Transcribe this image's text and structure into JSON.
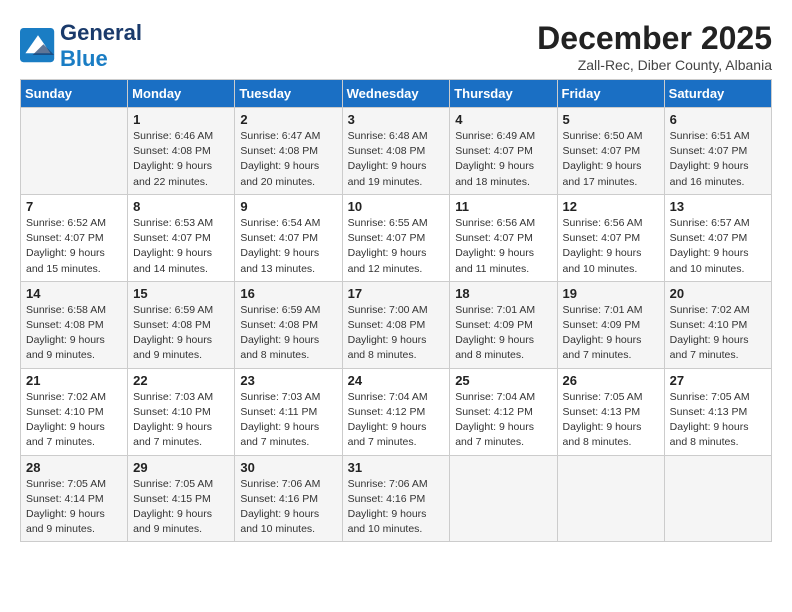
{
  "logo": {
    "general": "General",
    "blue": "Blue"
  },
  "title": "December 2025",
  "location": "Zall-Rec, Diber County, Albania",
  "days_of_week": [
    "Sunday",
    "Monday",
    "Tuesday",
    "Wednesday",
    "Thursday",
    "Friday",
    "Saturday"
  ],
  "weeks": [
    [
      {
        "day": "",
        "info": ""
      },
      {
        "day": "1",
        "info": "Sunrise: 6:46 AM\nSunset: 4:08 PM\nDaylight: 9 hours\nand 22 minutes."
      },
      {
        "day": "2",
        "info": "Sunrise: 6:47 AM\nSunset: 4:08 PM\nDaylight: 9 hours\nand 20 minutes."
      },
      {
        "day": "3",
        "info": "Sunrise: 6:48 AM\nSunset: 4:08 PM\nDaylight: 9 hours\nand 19 minutes."
      },
      {
        "day": "4",
        "info": "Sunrise: 6:49 AM\nSunset: 4:07 PM\nDaylight: 9 hours\nand 18 minutes."
      },
      {
        "day": "5",
        "info": "Sunrise: 6:50 AM\nSunset: 4:07 PM\nDaylight: 9 hours\nand 17 minutes."
      },
      {
        "day": "6",
        "info": "Sunrise: 6:51 AM\nSunset: 4:07 PM\nDaylight: 9 hours\nand 16 minutes."
      }
    ],
    [
      {
        "day": "7",
        "info": "Sunrise: 6:52 AM\nSunset: 4:07 PM\nDaylight: 9 hours\nand 15 minutes."
      },
      {
        "day": "8",
        "info": "Sunrise: 6:53 AM\nSunset: 4:07 PM\nDaylight: 9 hours\nand 14 minutes."
      },
      {
        "day": "9",
        "info": "Sunrise: 6:54 AM\nSunset: 4:07 PM\nDaylight: 9 hours\nand 13 minutes."
      },
      {
        "day": "10",
        "info": "Sunrise: 6:55 AM\nSunset: 4:07 PM\nDaylight: 9 hours\nand 12 minutes."
      },
      {
        "day": "11",
        "info": "Sunrise: 6:56 AM\nSunset: 4:07 PM\nDaylight: 9 hours\nand 11 minutes."
      },
      {
        "day": "12",
        "info": "Sunrise: 6:56 AM\nSunset: 4:07 PM\nDaylight: 9 hours\nand 10 minutes."
      },
      {
        "day": "13",
        "info": "Sunrise: 6:57 AM\nSunset: 4:07 PM\nDaylight: 9 hours\nand 10 minutes."
      }
    ],
    [
      {
        "day": "14",
        "info": "Sunrise: 6:58 AM\nSunset: 4:08 PM\nDaylight: 9 hours\nand 9 minutes."
      },
      {
        "day": "15",
        "info": "Sunrise: 6:59 AM\nSunset: 4:08 PM\nDaylight: 9 hours\nand 9 minutes."
      },
      {
        "day": "16",
        "info": "Sunrise: 6:59 AM\nSunset: 4:08 PM\nDaylight: 9 hours\nand 8 minutes."
      },
      {
        "day": "17",
        "info": "Sunrise: 7:00 AM\nSunset: 4:08 PM\nDaylight: 9 hours\nand 8 minutes."
      },
      {
        "day": "18",
        "info": "Sunrise: 7:01 AM\nSunset: 4:09 PM\nDaylight: 9 hours\nand 8 minutes."
      },
      {
        "day": "19",
        "info": "Sunrise: 7:01 AM\nSunset: 4:09 PM\nDaylight: 9 hours\nand 7 minutes."
      },
      {
        "day": "20",
        "info": "Sunrise: 7:02 AM\nSunset: 4:10 PM\nDaylight: 9 hours\nand 7 minutes."
      }
    ],
    [
      {
        "day": "21",
        "info": "Sunrise: 7:02 AM\nSunset: 4:10 PM\nDaylight: 9 hours\nand 7 minutes."
      },
      {
        "day": "22",
        "info": "Sunrise: 7:03 AM\nSunset: 4:10 PM\nDaylight: 9 hours\nand 7 minutes."
      },
      {
        "day": "23",
        "info": "Sunrise: 7:03 AM\nSunset: 4:11 PM\nDaylight: 9 hours\nand 7 minutes."
      },
      {
        "day": "24",
        "info": "Sunrise: 7:04 AM\nSunset: 4:12 PM\nDaylight: 9 hours\nand 7 minutes."
      },
      {
        "day": "25",
        "info": "Sunrise: 7:04 AM\nSunset: 4:12 PM\nDaylight: 9 hours\nand 7 minutes."
      },
      {
        "day": "26",
        "info": "Sunrise: 7:05 AM\nSunset: 4:13 PM\nDaylight: 9 hours\nand 8 minutes."
      },
      {
        "day": "27",
        "info": "Sunrise: 7:05 AM\nSunset: 4:13 PM\nDaylight: 9 hours\nand 8 minutes."
      }
    ],
    [
      {
        "day": "28",
        "info": "Sunrise: 7:05 AM\nSunset: 4:14 PM\nDaylight: 9 hours\nand 9 minutes."
      },
      {
        "day": "29",
        "info": "Sunrise: 7:05 AM\nSunset: 4:15 PM\nDaylight: 9 hours\nand 9 minutes."
      },
      {
        "day": "30",
        "info": "Sunrise: 7:06 AM\nSunset: 4:16 PM\nDaylight: 9 hours\nand 10 minutes."
      },
      {
        "day": "31",
        "info": "Sunrise: 7:06 AM\nSunset: 4:16 PM\nDaylight: 9 hours\nand 10 minutes."
      },
      {
        "day": "",
        "info": ""
      },
      {
        "day": "",
        "info": ""
      },
      {
        "day": "",
        "info": ""
      }
    ]
  ]
}
